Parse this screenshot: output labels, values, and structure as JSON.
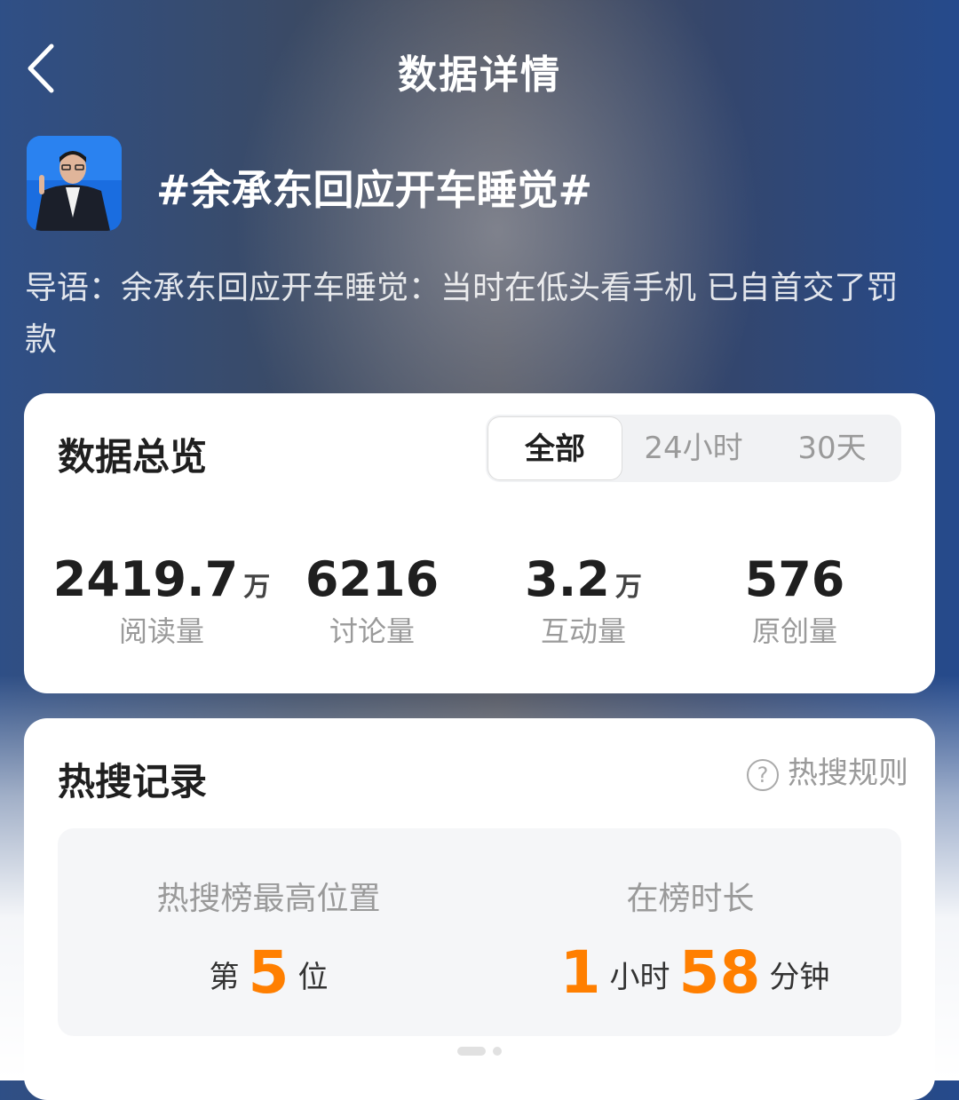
{
  "nav": {
    "title": "数据详情"
  },
  "topic": {
    "title": "#余承东回应开车睡觉#",
    "lead": "导语：余承东回应开车睡觉：当时在低头看手机 已自首交了罚款"
  },
  "overview": {
    "heading": "数据总览",
    "filters": [
      {
        "label": "全部",
        "active": true
      },
      {
        "label": "24小时",
        "active": false
      },
      {
        "label": "30天",
        "active": false
      }
    ],
    "stats": [
      {
        "value": "2419.7",
        "unit": "万",
        "label": "阅读量"
      },
      {
        "value": "6216",
        "unit": "",
        "label": "讨论量"
      },
      {
        "value": "3.2",
        "unit": "万",
        "label": "互动量"
      },
      {
        "value": "576",
        "unit": "",
        "label": "原创量"
      }
    ]
  },
  "hot": {
    "heading": "热搜记录",
    "rules_label": "热搜规则",
    "rules_icon": "question-circle-icon",
    "peak": {
      "label": "热搜榜最高位置",
      "prefix": "第",
      "rank": "5",
      "suffix": "位"
    },
    "duration": {
      "label": "在榜时长",
      "hours": "1",
      "hours_unit": "小时",
      "minutes": "58",
      "minutes_unit": "分钟"
    }
  },
  "colors": {
    "accent": "#ff7f00",
    "heading": "#1f1f1f",
    "muted": "#9a9a9a"
  }
}
